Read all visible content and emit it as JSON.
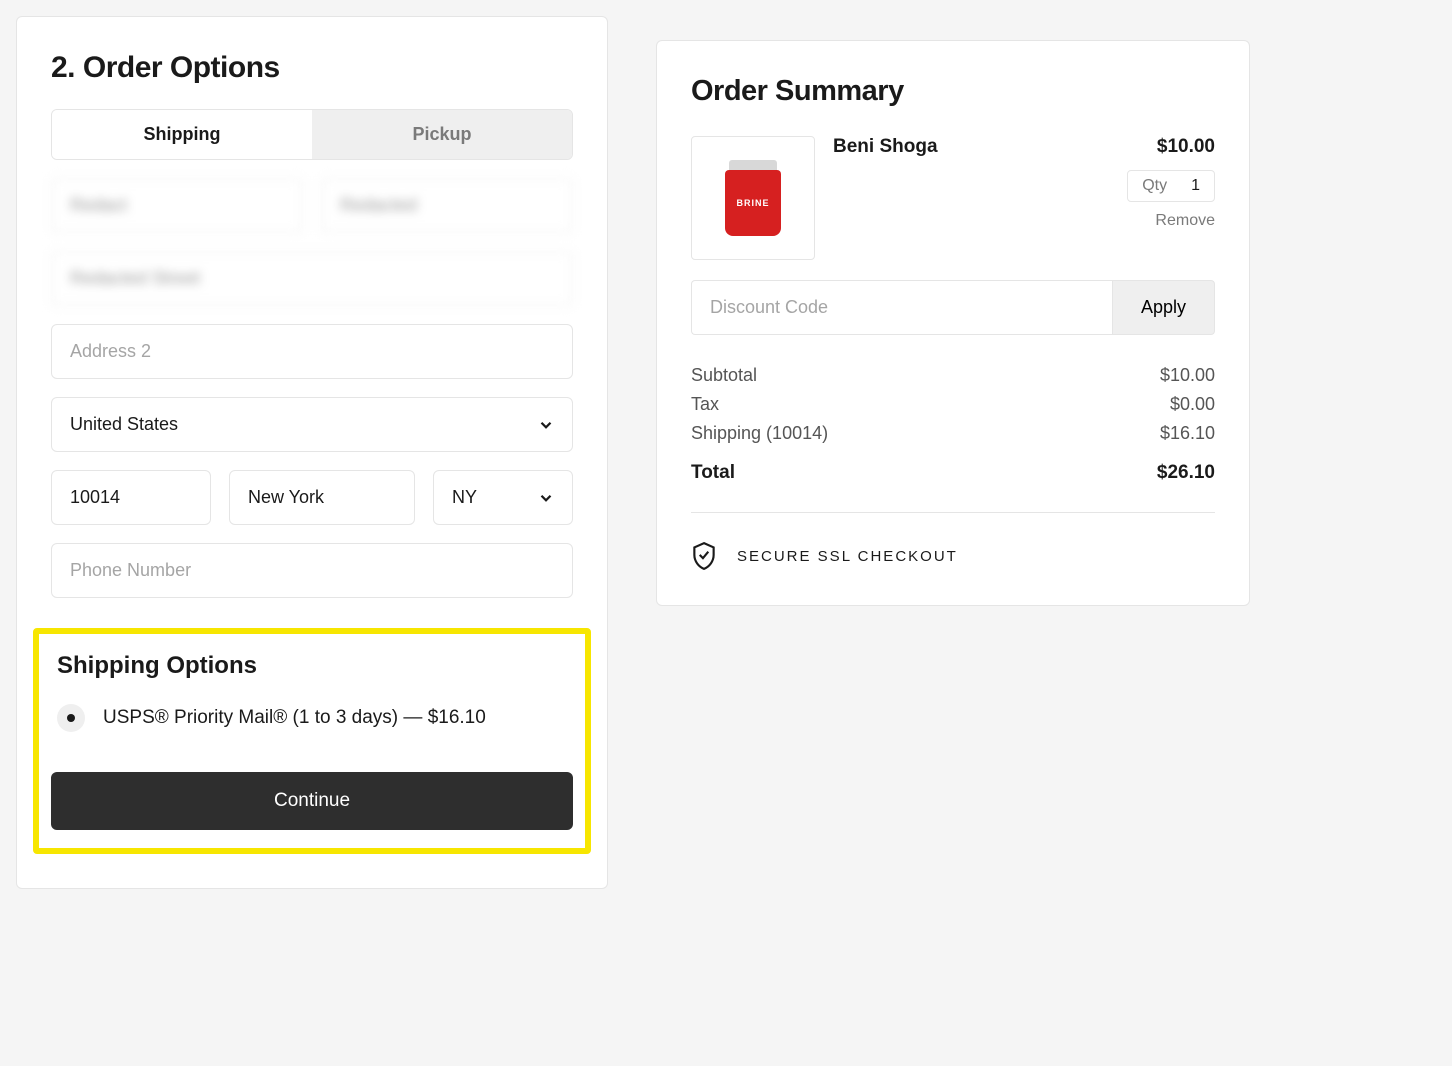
{
  "orderOptions": {
    "title": "2.  Order Options",
    "tabs": {
      "shipping": "Shipping",
      "pickup": "Pickup"
    },
    "fields": {
      "firstName": "Redact",
      "lastName": "Redacted",
      "address1": "Redacted Street",
      "address2Placeholder": "Address 2",
      "country": "United States",
      "zip": "10014",
      "city": "New York",
      "state": "NY",
      "phonePlaceholder": "Phone Number"
    },
    "shippingOptions": {
      "title": "Shipping Options",
      "option": "USPS® Priority Mail® (1 to 3 days) — $16.10"
    },
    "continueLabel": "Continue"
  },
  "summary": {
    "title": "Order Summary",
    "product": {
      "name": "Beni Shoga",
      "price": "$10.00",
      "qtyLabel": "Qty",
      "qty": "1",
      "jarLabel": "BRINE",
      "removeLabel": "Remove"
    },
    "discountPlaceholder": "Discount Code",
    "applyLabel": "Apply",
    "lines": {
      "subtotalLabel": "Subtotal",
      "subtotal": "$10.00",
      "taxLabel": "Tax",
      "tax": "$0.00",
      "shippingLabel": "Shipping (10014)",
      "shipping": "$16.10",
      "totalLabel": "Total",
      "total": "$26.10"
    },
    "secureLabel": "SECURE SSL CHECKOUT"
  }
}
